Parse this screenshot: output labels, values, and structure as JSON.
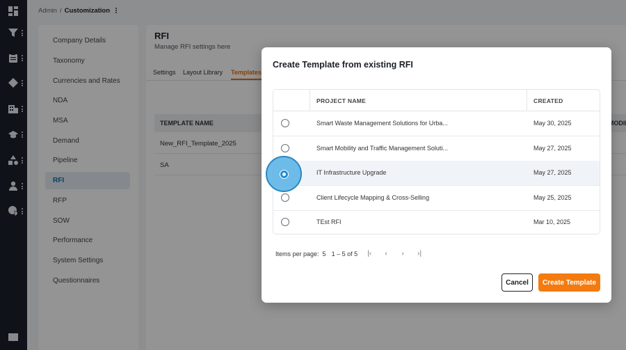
{
  "rail": {
    "items": [
      {
        "icon": "dashboard-icon"
      },
      {
        "icon": "filter-icon"
      },
      {
        "icon": "clipboard-icon"
      },
      {
        "icon": "tag-icon"
      },
      {
        "icon": "building-icon"
      },
      {
        "icon": "graduation-cap-icon"
      },
      {
        "icon": "shapes-icon"
      },
      {
        "icon": "user-icon"
      },
      {
        "icon": "user-shield-icon"
      }
    ],
    "bottom_icon": "book-icon"
  },
  "breadcrumb": {
    "root": "Admin",
    "separator": "/",
    "current": "Customization"
  },
  "leftnav": {
    "items": [
      {
        "label": "Company Details"
      },
      {
        "label": "Taxonomy"
      },
      {
        "label": "Currencies and Rates"
      },
      {
        "label": "NDA"
      },
      {
        "label": "MSA"
      },
      {
        "label": "Demand"
      },
      {
        "label": "Pipeline"
      },
      {
        "label": "RFI",
        "active": true
      },
      {
        "label": "RFP"
      },
      {
        "label": "SOW"
      },
      {
        "label": "Performance"
      },
      {
        "label": "System Settings"
      },
      {
        "label": "Questionnaires"
      }
    ]
  },
  "page": {
    "title": "RFI",
    "subtitle": "Manage RFI settings here",
    "tabs": [
      {
        "label": "Settings"
      },
      {
        "label": "Layout Library"
      },
      {
        "label": "Templates",
        "active": true
      }
    ],
    "table": {
      "header": "TEMPLATE NAME",
      "header_right": "MODIF",
      "rows": [
        "New_RFI_Template_2025",
        "SA"
      ]
    }
  },
  "modal": {
    "title": "Create Template from existing RFI",
    "columns": {
      "name": "PROJECT NAME",
      "created": "CREATED"
    },
    "rows": [
      {
        "name": "Smart Waste Management Solutions for Urba...",
        "created": "May 30, 2025"
      },
      {
        "name": "Smart Mobility and Traffic Management Soluti...",
        "created": "May 27, 2025"
      },
      {
        "name": "IT Infrastructure Upgrade",
        "created": "May 27, 2025",
        "selected": true
      },
      {
        "name": "Client Lifecycle Mapping & Cross-Selling",
        "created": "May 25, 2025"
      },
      {
        "name": "TEst RFI",
        "created": "Mar 10, 2025"
      }
    ],
    "pager": {
      "label": "Items per page:",
      "value": "5",
      "range": "1 – 5 of 5",
      "first": "|‹",
      "prev": "‹",
      "next": "›",
      "last": "›|"
    },
    "buttons": {
      "cancel": "Cancel",
      "create": "Create Template"
    }
  },
  "colors": {
    "accent": "#f47b0f",
    "selected_radio": "#1d8fd6",
    "rail_bg": "#1b1f2a"
  }
}
